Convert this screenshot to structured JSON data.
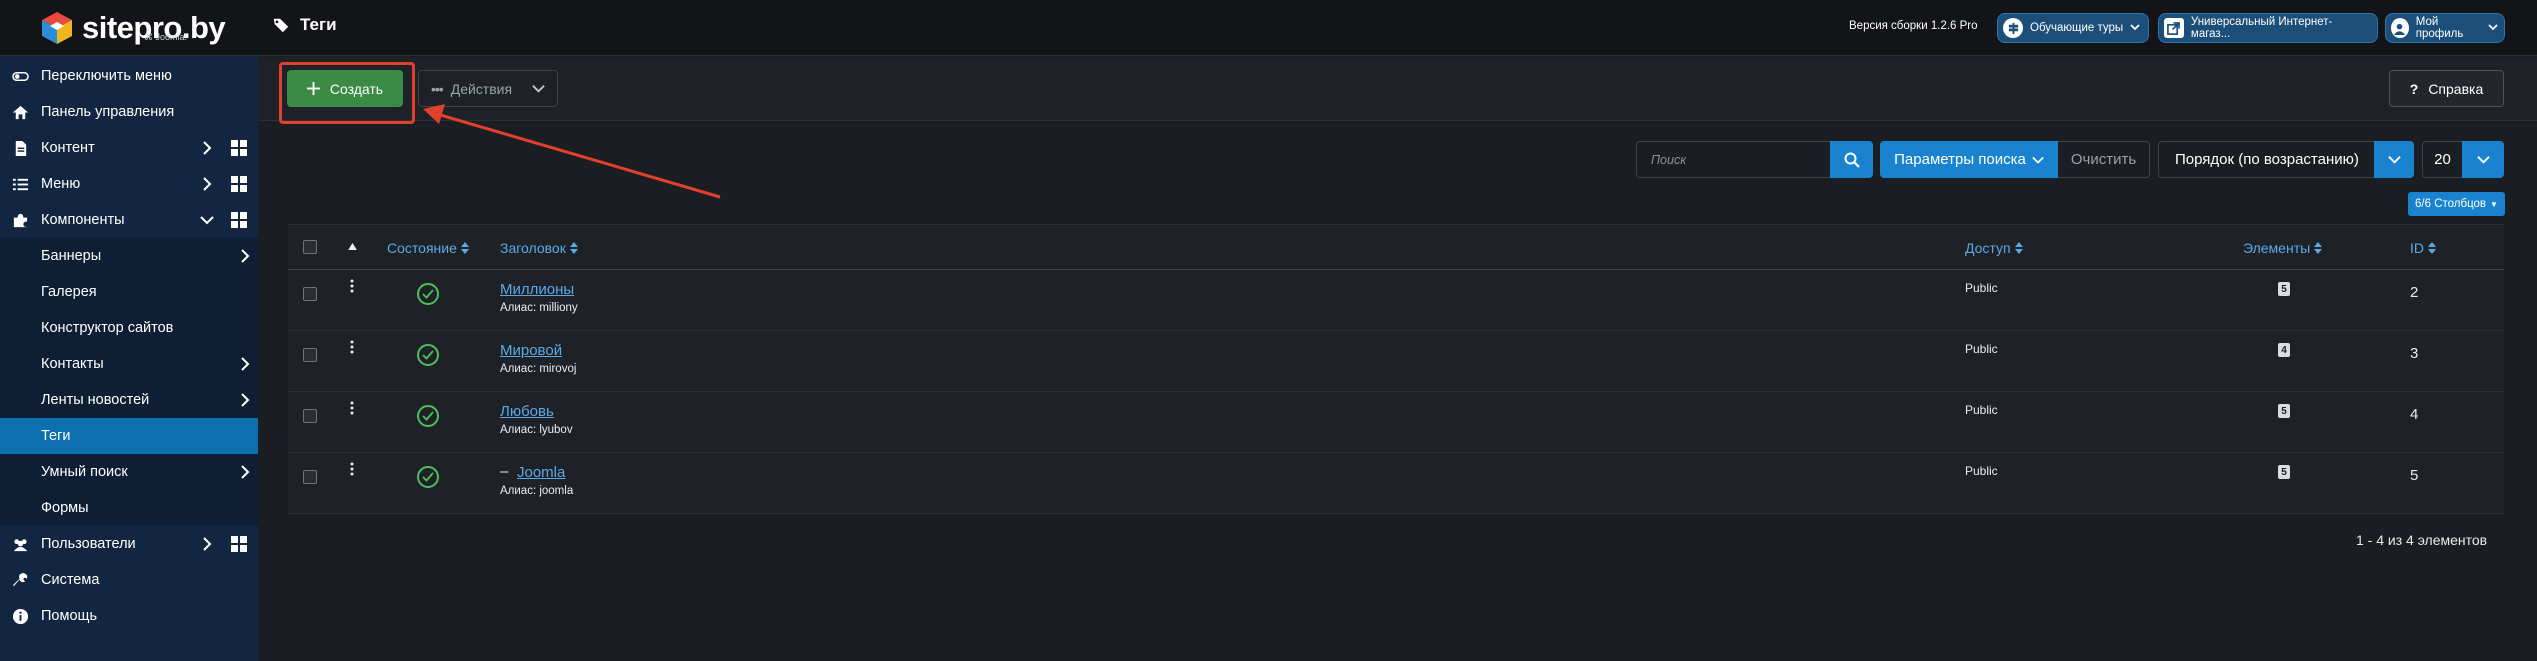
{
  "header": {
    "logo_text": "sitepro.by",
    "logo_sub": "⌘ Joomla!",
    "page_title": "Теги",
    "version": "Версия сборки 1.2.6 Pro",
    "buttons": [
      {
        "label": "Обучающие туры",
        "icon": "signpost-icon"
      },
      {
        "label": "Универсальный Интернет-магаз...",
        "icon": "external-link-icon"
      },
      {
        "label": "Мой профиль",
        "icon": "user-icon"
      }
    ]
  },
  "sidebar": {
    "items": [
      {
        "label": "Переключить меню",
        "icon": "toggle-icon"
      },
      {
        "label": "Панель управления",
        "icon": "home-icon"
      },
      {
        "label": "Контент",
        "icon": "file-icon"
      },
      {
        "label": "Меню",
        "icon": "list-icon"
      },
      {
        "label": "Компоненты",
        "icon": "puzzle-icon"
      },
      {
        "label": "Баннеры"
      },
      {
        "label": "Галерея"
      },
      {
        "label": "Конструктор сайтов"
      },
      {
        "label": "Контакты"
      },
      {
        "label": "Ленты новостей"
      },
      {
        "label": "Теги"
      },
      {
        "label": "Умный поиск"
      },
      {
        "label": "Формы"
      },
      {
        "label": "Пользователи",
        "icon": "users-icon"
      },
      {
        "label": "Система",
        "icon": "wrench-icon"
      },
      {
        "label": "Помощь",
        "icon": "info-icon"
      }
    ]
  },
  "toolbar": {
    "create_label": "Создать",
    "actions_label": "Действия",
    "help_label": "Справка"
  },
  "filters": {
    "search_placeholder": "Поиск",
    "params_label": "Параметры поиска",
    "clear_label": "Очистить",
    "order_label": "Порядок (по возрастанию)",
    "limit": "20",
    "columns_label": "6/6 Столбцов"
  },
  "table": {
    "headers": {
      "status": "Состояние",
      "title": "Заголовок",
      "access": "Доступ",
      "items": "Элементы",
      "id": "ID"
    },
    "rows": [
      {
        "title": "Миллионы",
        "prefix": "",
        "alias": "Алиас: milliony",
        "access": "Public",
        "count": "5",
        "id": "2"
      },
      {
        "title": "Мировой",
        "prefix": "",
        "alias": "Алиас: mirovoj",
        "access": "Public",
        "count": "4",
        "id": "3"
      },
      {
        "title": "Любовь",
        "prefix": "",
        "alias": "Алиас: lyubov",
        "access": "Public",
        "count": "5",
        "id": "4"
      },
      {
        "title": "Joomla",
        "prefix": "–",
        "alias": "Алиас: joomla",
        "access": "Public",
        "count": "5",
        "id": "5"
      }
    ]
  },
  "pagination": "1 - 4 из 4 элементов",
  "colors": {
    "sidebar": "#132641",
    "active": "#0c6fae",
    "primary": "#1a83cf",
    "success": "#3c8b45",
    "annotation": "#e0402c"
  }
}
